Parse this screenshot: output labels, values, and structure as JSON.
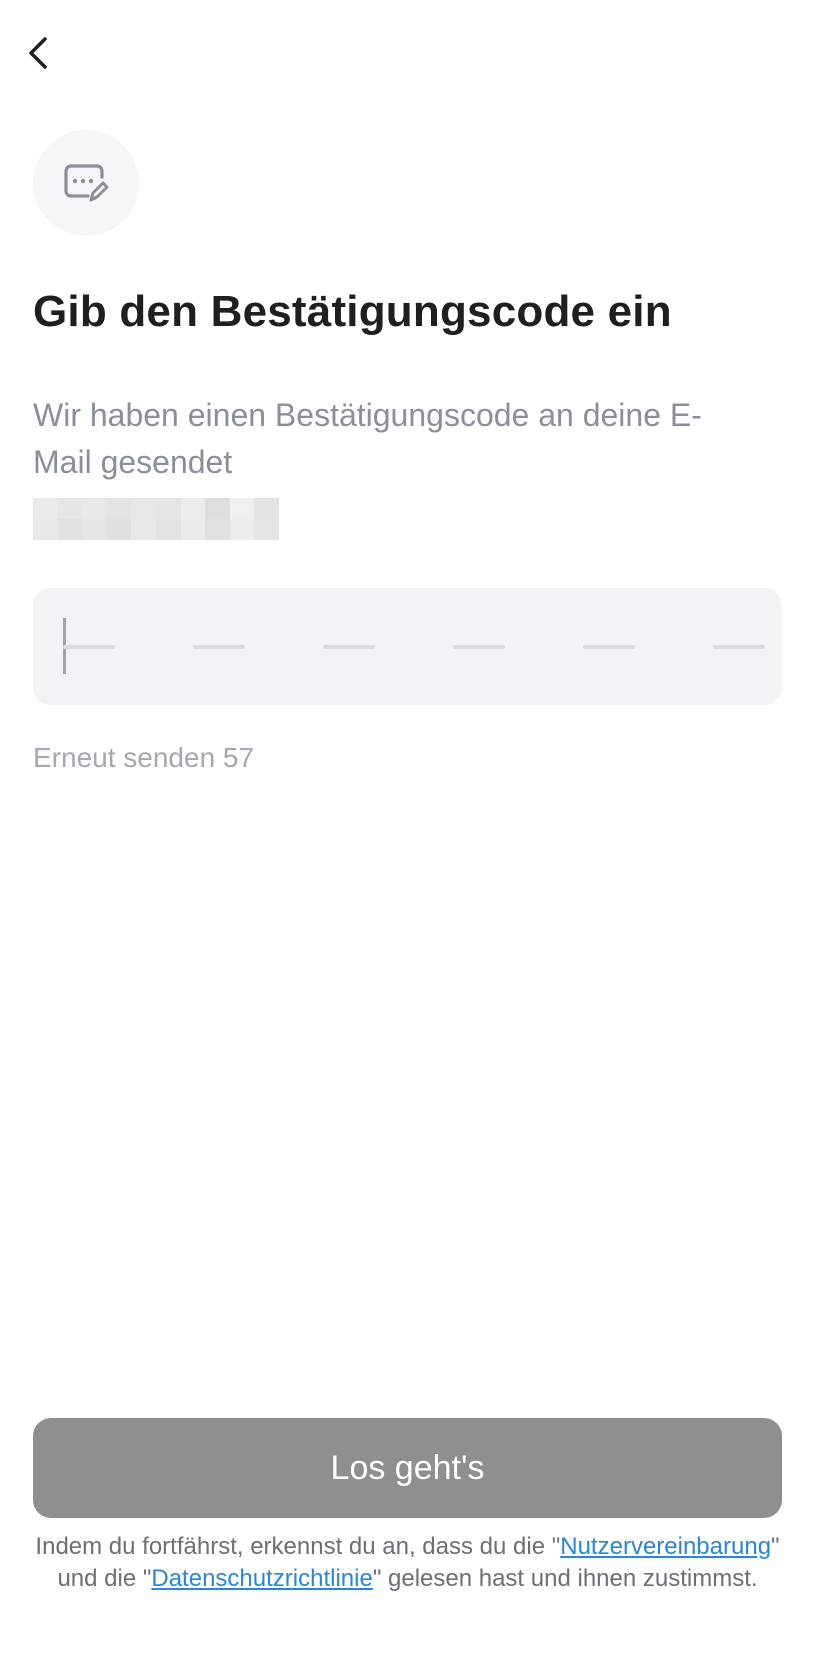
{
  "header": {
    "back_icon": "chevron-left-icon"
  },
  "badge": {
    "icon": "message-edit-icon"
  },
  "title": "Gib den Bestätigungscode ein",
  "subtitle": "Wir haben einen Bestätigungscode an deine E-Mail gesendet",
  "otp": {
    "length": 6,
    "value": ""
  },
  "resend": {
    "label": "Erneut senden 57"
  },
  "primary_button": {
    "label": "Los geht's",
    "disabled": true
  },
  "legal": {
    "text_before": "Indem du fortfährst, erkennst du an, dass du die \"",
    "link_terms": "Nutzervereinbarung",
    "text_middle": "\" und die \"",
    "link_privacy": "Datenschutzrichtlinie",
    "text_after": "\" gelesen hast und ihnen zustimmst."
  },
  "colors": {
    "title": "#1f1f1f",
    "subtitle": "#8a8f99",
    "otp_background": "#f2f3f6",
    "button_disabled": "#8f8f8f",
    "link": "#2a86d8"
  }
}
